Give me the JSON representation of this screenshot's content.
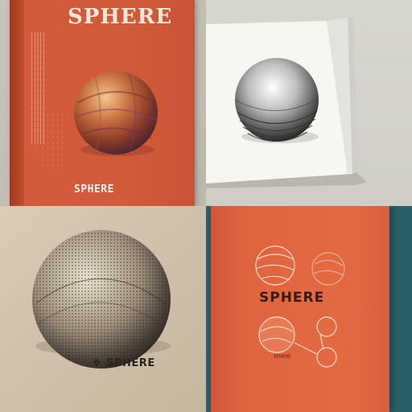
{
  "panels": [
    {
      "title": "SPHERE",
      "subtitle": "SPHERE"
    },
    {},
    {
      "label": "SPHERE",
      "mark": "❖"
    },
    {
      "title": "SPHERE",
      "caption": "SPHERE"
    }
  ],
  "colors": {
    "cover_orange": "#d35b3b",
    "page_white": "#f4f4f1",
    "ink": "#2a2420",
    "teal_backdrop": "#2c6069"
  }
}
